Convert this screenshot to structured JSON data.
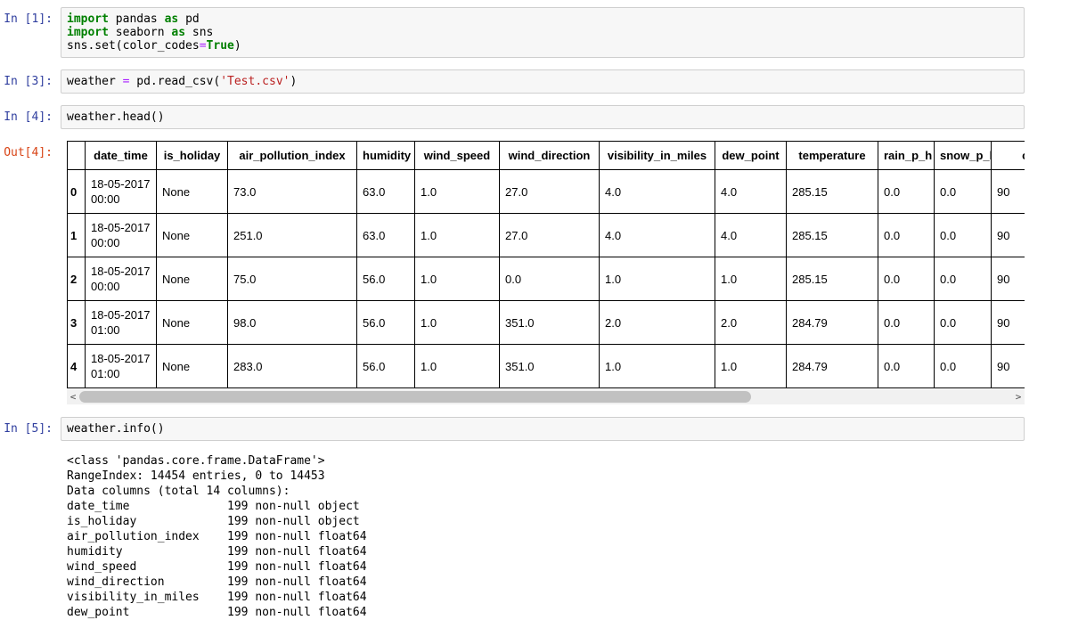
{
  "colors": {
    "input_prompt": "#303F9F",
    "output_prompt": "#D84315",
    "syntax_keyword": "#008000",
    "syntax_string": "#BA2121",
    "syntax_operator": "#AA22FF",
    "cell_background": "#f7f7f7",
    "cell_border": "#cfcfcf",
    "scrollbar_thumb": "#c1c1c1",
    "scrollbar_track": "#f1f1f1"
  },
  "cells": {
    "in1": {
      "prompt": "In [1]:",
      "lines": [
        [
          [
            "k",
            "import"
          ],
          [
            "p",
            " pandas "
          ],
          [
            "k",
            "as"
          ],
          [
            "p",
            " pd"
          ]
        ],
        [
          [
            "k",
            "import"
          ],
          [
            "p",
            " seaborn "
          ],
          [
            "k",
            "as"
          ],
          [
            "p",
            " sns"
          ]
        ],
        [
          [
            "p",
            "sns.set(color_codes"
          ],
          [
            "o",
            "="
          ],
          [
            "k",
            "True"
          ],
          [
            "p",
            ")"
          ]
        ]
      ]
    },
    "in3": {
      "prompt": "In [3]:",
      "lines": [
        [
          [
            "p",
            "weather "
          ],
          [
            "o",
            "="
          ],
          [
            "p",
            " pd.read_csv("
          ],
          [
            "s",
            "'Test.csv'"
          ],
          [
            "p",
            ")"
          ]
        ]
      ]
    },
    "in4": {
      "prompt": "In [4]:",
      "lines": [
        [
          [
            "p",
            "weather.head()"
          ]
        ]
      ]
    },
    "out4": {
      "prompt": "Out[4]:"
    },
    "in5": {
      "prompt": "In [5]:",
      "lines": [
        [
          [
            "p",
            "weather.info()"
          ]
        ]
      ]
    }
  },
  "dataframe": {
    "index_header": "",
    "columns": [
      "date_time",
      "is_holiday",
      "air_pollution_index",
      "humidity",
      "wind_speed",
      "wind_direction",
      "visibility_in_miles",
      "dew_point",
      "temperature",
      "rain_p_h",
      "snow_p_h",
      "cl"
    ],
    "rows": [
      {
        "index": "0",
        "values": [
          "18-05-2017 00:00",
          "None",
          "73.0",
          "63.0",
          "1.0",
          "27.0",
          "4.0",
          "4.0",
          "285.15",
          "0.0",
          "0.0",
          "90"
        ]
      },
      {
        "index": "1",
        "values": [
          "18-05-2017 00:00",
          "None",
          "251.0",
          "63.0",
          "1.0",
          "27.0",
          "4.0",
          "4.0",
          "285.15",
          "0.0",
          "0.0",
          "90"
        ]
      },
      {
        "index": "2",
        "values": [
          "18-05-2017 00:00",
          "None",
          "75.0",
          "56.0",
          "1.0",
          "0.0",
          "1.0",
          "1.0",
          "285.15",
          "0.0",
          "0.0",
          "90"
        ]
      },
      {
        "index": "3",
        "values": [
          "18-05-2017 01:00",
          "None",
          "98.0",
          "56.0",
          "1.0",
          "351.0",
          "2.0",
          "2.0",
          "284.79",
          "0.0",
          "0.0",
          "90"
        ]
      },
      {
        "index": "4",
        "values": [
          "18-05-2017 01:00",
          "None",
          "283.0",
          "56.0",
          "1.0",
          "351.0",
          "1.0",
          "1.0",
          "284.79",
          "0.0",
          "0.0",
          "90"
        ]
      }
    ]
  },
  "scrollbar": {
    "left_arrow": "<",
    "right_arrow": ">"
  },
  "info_output": {
    "lines": [
      "<class 'pandas.core.frame.DataFrame'>",
      "RangeIndex: 14454 entries, 0 to 14453",
      "Data columns (total 14 columns):",
      "date_time              199 non-null object",
      "is_holiday             199 non-null object",
      "air_pollution_index    199 non-null float64",
      "humidity               199 non-null float64",
      "wind_speed             199 non-null float64",
      "wind_direction         199 non-null float64",
      "visibility_in_miles    199 non-null float64",
      "dew_point              199 non-null float64"
    ]
  }
}
